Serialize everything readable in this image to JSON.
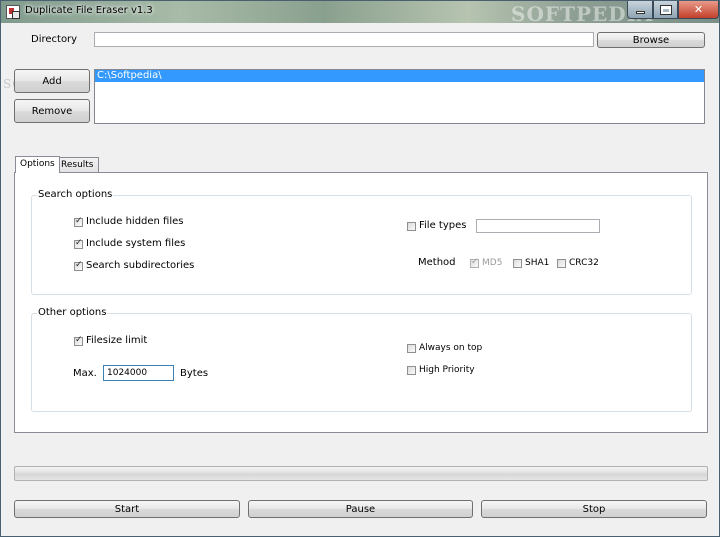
{
  "window": {
    "title": "Duplicate File Eraser v1.3",
    "watermark": "SOFTPEDIA"
  },
  "directory": {
    "label": "Directory",
    "value": "",
    "browse_label": "Browse"
  },
  "dir_buttons": {
    "add_label": "Add",
    "remove_label": "Remove"
  },
  "dir_list": {
    "items": [
      "C:\\Softpedia\\"
    ],
    "selected_index": 0
  },
  "tabs": [
    {
      "label": "Options",
      "active": true
    },
    {
      "label": "Results",
      "active": false
    }
  ],
  "search_options": {
    "title": "Search options",
    "include_hidden": {
      "label": "Include hidden files",
      "checked": true
    },
    "include_system": {
      "label": "Include system files",
      "checked": true
    },
    "search_subdirs": {
      "label": "Search subdirectories",
      "checked": true
    },
    "file_types": {
      "label": "File types",
      "checked": false,
      "value": ""
    },
    "method": {
      "label": "Method",
      "md5": {
        "label": "MD5",
        "checked": true,
        "disabled": true
      },
      "sha1": {
        "label": "SHA1",
        "checked": false
      },
      "crc32": {
        "label": "CRC32",
        "checked": false
      }
    }
  },
  "other_options": {
    "title": "Other options",
    "filesize_limit": {
      "label": "Filesize limit",
      "checked": true
    },
    "max_label": "Max.",
    "max_value": "1024000",
    "unit_label": "Bytes",
    "always_on_top": {
      "label": "Always on top",
      "checked": false
    },
    "high_priority": {
      "label": "High Priority",
      "checked": false
    }
  },
  "progress": {
    "value": 0
  },
  "actions": {
    "start_label": "Start",
    "pause_label": "Pause",
    "stop_label": "Stop"
  },
  "colors": {
    "selection": "#3399ff",
    "titlebar": "#8aa08e",
    "close_button": "#c2402a"
  }
}
